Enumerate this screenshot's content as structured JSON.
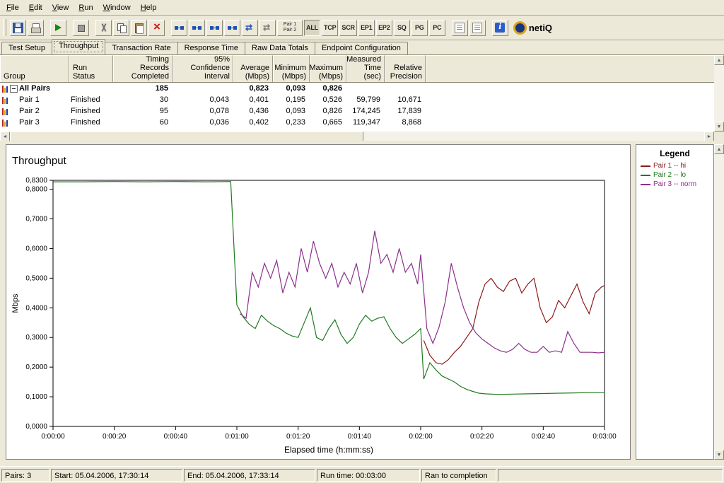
{
  "menu": {
    "items": [
      "File",
      "Edit",
      "View",
      "Run",
      "Window",
      "Help"
    ]
  },
  "toolbar": {
    "buttons": [
      {
        "name": "save-button",
        "icon": "floppy"
      },
      {
        "name": "print-button",
        "icon": "printer"
      },
      {
        "sep": true
      },
      {
        "name": "run-test-button",
        "icon": "run"
      },
      {
        "sep": true
      },
      {
        "name": "stop-test-button",
        "icon": "stop"
      },
      {
        "sep": true
      },
      {
        "name": "cut-button",
        "icon": "cut"
      },
      {
        "name": "copy-button",
        "icon": "copy"
      },
      {
        "name": "paste-button",
        "icon": "paste"
      },
      {
        "name": "delete-button",
        "icon": "delete"
      },
      {
        "sep": true
      },
      {
        "name": "add-pair-button",
        "icon": "pair"
      },
      {
        "name": "add-multicast-group-button",
        "icon": "pair"
      },
      {
        "name": "edit-pair-button",
        "icon": "pair"
      },
      {
        "name": "replicate-pair-button",
        "icon": "pair"
      },
      {
        "name": "swap-endpoints-button",
        "icon": "swap"
      },
      {
        "name": "reverse-pair-button",
        "icon": "swap2"
      },
      {
        "name": "pair1-pair2-button",
        "lines": [
          "Pair 1",
          "Pair 2"
        ]
      },
      {
        "name": "filter-all-button",
        "label": "ALL",
        "pressed": true
      },
      {
        "name": "filter-tcp-button",
        "label": "TCP"
      },
      {
        "name": "filter-scr-button",
        "label": "SCR"
      },
      {
        "name": "filter-ep1-button",
        "label": "EP1"
      },
      {
        "name": "filter-ep2-button",
        "label": "EP2"
      },
      {
        "name": "filter-sq-button",
        "label": "SQ"
      },
      {
        "name": "filter-pg-button",
        "label": "PG"
      },
      {
        "name": "filter-pc-button",
        "label": "PC"
      },
      {
        "sep": true
      },
      {
        "name": "report-view-button",
        "icon": "report"
      },
      {
        "name": "report-options-button",
        "icon": "report"
      },
      {
        "sep": true
      },
      {
        "name": "info-button",
        "icon": "info"
      },
      {
        "name": "netiq-logo",
        "icon": "netiq",
        "label": "netiQ",
        "logo": true
      }
    ]
  },
  "tabs": {
    "active_index": 1,
    "items": [
      "Test Setup",
      "Throughput",
      "Transaction Rate",
      "Response Time",
      "Raw Data Totals",
      "Endpoint Configuration"
    ]
  },
  "table": {
    "columns": [
      {
        "label": "Group",
        "align": "left"
      },
      {
        "label": "Run Status",
        "align": "left"
      },
      {
        "label": "Timing Records\nCompleted",
        "align": "right"
      },
      {
        "label": "95% Confidence\nInterval",
        "align": "right"
      },
      {
        "label": "Average\n(Mbps)",
        "align": "right"
      },
      {
        "label": "Minimum\n(Mbps)",
        "align": "right"
      },
      {
        "label": "Maximum\n(Mbps)",
        "align": "right"
      },
      {
        "label": "Measured\nTime (sec)",
        "align": "right"
      },
      {
        "label": "Relative\nPrecision",
        "align": "right"
      }
    ],
    "rows": [
      {
        "group": "All Pairs",
        "expandable": true,
        "bold": true,
        "cells": [
          "",
          "185",
          "",
          "0,823",
          "0,093",
          "0,826",
          "",
          ""
        ]
      },
      {
        "group": "Pair 1",
        "cells": [
          "Finished",
          "30",
          "0,043",
          "0,401",
          "0,195",
          "0,526",
          "59,799",
          "10,671"
        ]
      },
      {
        "group": "Pair 2",
        "cells": [
          "Finished",
          "95",
          "0,078",
          "0,436",
          "0,093",
          "0,826",
          "174,245",
          "17,839"
        ]
      },
      {
        "group": "Pair 3",
        "cells": [
          "Finished",
          "60",
          "0,036",
          "0,402",
          "0,233",
          "0,665",
          "119,347",
          "8,868"
        ]
      }
    ]
  },
  "chart_data": {
    "type": "line",
    "title": "Throughput",
    "xlabel": "Elapsed time (h:mm:ss)",
    "ylabel": "Mbps",
    "xlim": [
      0,
      180
    ],
    "ylim": [
      0,
      0.83
    ],
    "grid": false,
    "legend_position": "right",
    "x_ticks": [
      {
        "v": 0,
        "label": "0:00:00"
      },
      {
        "v": 20,
        "label": "0:00:20"
      },
      {
        "v": 40,
        "label": "0:00:40"
      },
      {
        "v": 60,
        "label": "0:01:00"
      },
      {
        "v": 80,
        "label": "0:01:20"
      },
      {
        "v": 100,
        "label": "0:01:40"
      },
      {
        "v": 120,
        "label": "0:02:00"
      },
      {
        "v": 140,
        "label": "0:02:20"
      },
      {
        "v": 160,
        "label": "0:02:40"
      },
      {
        "v": 180,
        "label": "0:03:00"
      }
    ],
    "y_ticks": [
      {
        "v": 0.83,
        "label": "0,8300"
      },
      {
        "v": 0.8,
        "label": "0,8000"
      },
      {
        "v": 0.7,
        "label": "0,7000"
      },
      {
        "v": 0.6,
        "label": "0,6000"
      },
      {
        "v": 0.5,
        "label": "0,5000"
      },
      {
        "v": 0.4,
        "label": "0,4000"
      },
      {
        "v": 0.3,
        "label": "0,3000"
      },
      {
        "v": 0.2,
        "label": "0,2000"
      },
      {
        "v": 0.1,
        "label": "0,1000"
      },
      {
        "v": 0,
        "label": "0,0000"
      }
    ],
    "series": [
      {
        "name": "Pair 1 -- hi",
        "color": "#8b1a1a",
        "points": [
          [
            121,
            0.29
          ],
          [
            123,
            0.24
          ],
          [
            125,
            0.215
          ],
          [
            127,
            0.21
          ],
          [
            129,
            0.225
          ],
          [
            131,
            0.25
          ],
          [
            133,
            0.27
          ],
          [
            135,
            0.3
          ],
          [
            137,
            0.33
          ],
          [
            139,
            0.42
          ],
          [
            141,
            0.48
          ],
          [
            143,
            0.5
          ],
          [
            145,
            0.47
          ],
          [
            147,
            0.455
          ],
          [
            149,
            0.49
          ],
          [
            151,
            0.5
          ],
          [
            153,
            0.45
          ],
          [
            155,
            0.48
          ],
          [
            157,
            0.5
          ],
          [
            159,
            0.4
          ],
          [
            161,
            0.35
          ],
          [
            163,
            0.37
          ],
          [
            165,
            0.425
          ],
          [
            167,
            0.4
          ],
          [
            169,
            0.44
          ],
          [
            171,
            0.48
          ],
          [
            173,
            0.42
          ],
          [
            175,
            0.38
          ],
          [
            177,
            0.45
          ],
          [
            179,
            0.47
          ],
          [
            180,
            0.475
          ]
        ]
      },
      {
        "name": "Pair 2 -- lo",
        "color": "#1f7a1f",
        "points": [
          [
            0,
            0.825
          ],
          [
            10,
            0.825
          ],
          [
            20,
            0.826
          ],
          [
            30,
            0.825
          ],
          [
            40,
            0.826
          ],
          [
            50,
            0.825
          ],
          [
            58,
            0.826
          ],
          [
            60,
            0.41
          ],
          [
            62,
            0.37
          ],
          [
            64,
            0.345
          ],
          [
            66,
            0.33
          ],
          [
            68,
            0.375
          ],
          [
            70,
            0.355
          ],
          [
            72,
            0.34
          ],
          [
            74,
            0.33
          ],
          [
            76,
            0.315
          ],
          [
            78,
            0.305
          ],
          [
            80,
            0.3
          ],
          [
            82,
            0.35
          ],
          [
            84,
            0.4
          ],
          [
            86,
            0.3
          ],
          [
            88,
            0.29
          ],
          [
            90,
            0.33
          ],
          [
            92,
            0.36
          ],
          [
            94,
            0.31
          ],
          [
            96,
            0.28
          ],
          [
            98,
            0.3
          ],
          [
            100,
            0.345
          ],
          [
            102,
            0.375
          ],
          [
            104,
            0.355
          ],
          [
            106,
            0.365
          ],
          [
            108,
            0.37
          ],
          [
            110,
            0.33
          ],
          [
            112,
            0.3
          ],
          [
            114,
            0.28
          ],
          [
            116,
            0.295
          ],
          [
            118,
            0.31
          ],
          [
            120,
            0.33
          ],
          [
            121,
            0.16
          ],
          [
            123,
            0.215
          ],
          [
            125,
            0.19
          ],
          [
            127,
            0.17
          ],
          [
            129,
            0.16
          ],
          [
            131,
            0.15
          ],
          [
            133,
            0.135
          ],
          [
            135,
            0.125
          ],
          [
            137,
            0.118
          ],
          [
            139,
            0.112
          ],
          [
            141,
            0.11
          ],
          [
            145,
            0.108
          ],
          [
            150,
            0.109
          ],
          [
            155,
            0.11
          ],
          [
            160,
            0.111
          ],
          [
            165,
            0.112
          ],
          [
            170,
            0.113
          ],
          [
            175,
            0.114
          ],
          [
            180,
            0.114
          ]
        ]
      },
      {
        "name": "Pair 3 -- norm",
        "color": "#8b2f8b",
        "points": [
          [
            61,
            0.38
          ],
          [
            63,
            0.365
          ],
          [
            65,
            0.52
          ],
          [
            67,
            0.47
          ],
          [
            69,
            0.55
          ],
          [
            71,
            0.5
          ],
          [
            73,
            0.56
          ],
          [
            75,
            0.45
          ],
          [
            77,
            0.52
          ],
          [
            79,
            0.47
          ],
          [
            81,
            0.6
          ],
          [
            83,
            0.52
          ],
          [
            85,
            0.625
          ],
          [
            87,
            0.55
          ],
          [
            89,
            0.5
          ],
          [
            91,
            0.55
          ],
          [
            93,
            0.47
          ],
          [
            95,
            0.52
          ],
          [
            97,
            0.48
          ],
          [
            99,
            0.55
          ],
          [
            101,
            0.45
          ],
          [
            103,
            0.52
          ],
          [
            105,
            0.66
          ],
          [
            107,
            0.55
          ],
          [
            109,
            0.58
          ],
          [
            111,
            0.52
          ],
          [
            113,
            0.6
          ],
          [
            115,
            0.52
          ],
          [
            117,
            0.55
          ],
          [
            119,
            0.48
          ],
          [
            120,
            0.58
          ],
          [
            122,
            0.33
          ],
          [
            124,
            0.28
          ],
          [
            126,
            0.335
          ],
          [
            128,
            0.42
          ],
          [
            130,
            0.55
          ],
          [
            132,
            0.47
          ],
          [
            134,
            0.4
          ],
          [
            136,
            0.35
          ],
          [
            138,
            0.315
          ],
          [
            140,
            0.295
          ],
          [
            142,
            0.28
          ],
          [
            144,
            0.265
          ],
          [
            146,
            0.255
          ],
          [
            148,
            0.25
          ],
          [
            150,
            0.26
          ],
          [
            152,
            0.28
          ],
          [
            154,
            0.26
          ],
          [
            156,
            0.25
          ],
          [
            158,
            0.25
          ],
          [
            160,
            0.27
          ],
          [
            162,
            0.25
          ],
          [
            164,
            0.255
          ],
          [
            166,
            0.25
          ],
          [
            168,
            0.32
          ],
          [
            170,
            0.28
          ],
          [
            172,
            0.25
          ],
          [
            174,
            0.25
          ],
          [
            176,
            0.25
          ],
          [
            178,
            0.248
          ],
          [
            180,
            0.25
          ]
        ]
      }
    ]
  },
  "legend": {
    "title": "Legend",
    "items": [
      {
        "label": "Pair 1 -- hi",
        "color": "#8b1a1a"
      },
      {
        "label": "Pair 2 -- lo",
        "color": "#1f7a1f"
      },
      {
        "label": "Pair 3 -- norm",
        "color": "#8b2f8b"
      }
    ]
  },
  "statusbar": {
    "segments": [
      "Pairs: 3",
      "Start: 05.04.2006, 17:30:14",
      "End: 05.04.2006, 17:33:14",
      "Run time: 00:03:00",
      "Ran to completion"
    ]
  }
}
